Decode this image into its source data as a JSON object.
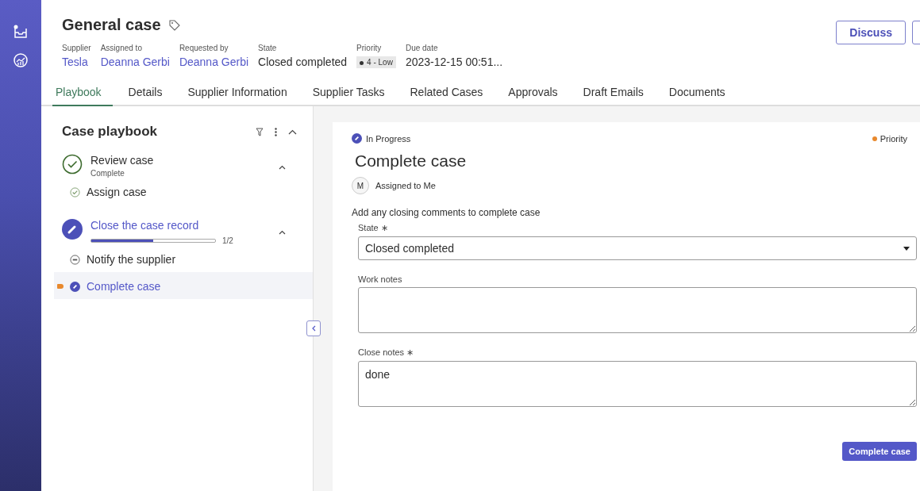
{
  "header": {
    "title": "General case",
    "fields": [
      {
        "label": "Supplier",
        "value": "Tesla",
        "kind": "link"
      },
      {
        "label": "Assigned to",
        "value": "Deanna Gerbi",
        "kind": "link"
      },
      {
        "label": "Requested by",
        "value": "Deanna Gerbi",
        "kind": "link"
      },
      {
        "label": "State",
        "value": "Closed completed",
        "kind": "text"
      },
      {
        "label": "Priority",
        "value": "4 - Low",
        "kind": "badge"
      },
      {
        "label": "Due date",
        "value": "2023-12-15 00:51...",
        "kind": "text"
      }
    ],
    "buttons": [
      "Discuss"
    ]
  },
  "tabs": [
    {
      "label": "Playbook",
      "selected": true
    },
    {
      "label": "Details",
      "selected": false
    },
    {
      "label": "Supplier Information",
      "selected": false
    },
    {
      "label": "Supplier Tasks",
      "selected": false
    },
    {
      "label": "Related Cases",
      "selected": false
    },
    {
      "label": "Approvals",
      "selected": false
    },
    {
      "label": "Draft Emails",
      "selected": false
    },
    {
      "label": "Documents",
      "selected": false
    }
  ],
  "playbook": {
    "title": "Case playbook",
    "groups": [
      {
        "title": "Review case",
        "kind": "complete",
        "subtitle": "Complete",
        "expanded": true,
        "children": [
          {
            "label": "Assign case",
            "kind": "complete",
            "selected": false
          }
        ]
      },
      {
        "title": "Close the case record",
        "kind": "active",
        "level": 0.5,
        "reading": "1/2",
        "expanded": true,
        "children": [
          {
            "label": "Notify the supplier",
            "kind": "pending",
            "selected": false
          },
          {
            "label": "Complete case",
            "kind": "active",
            "selected": true
          }
        ]
      }
    ]
  },
  "detail": {
    "status": "In Progress",
    "priority": "Priority",
    "title": "Complete case",
    "assignee_initial": "M",
    "assignee": "Assigned to Me",
    "instructions": "Add any closing comments to complete case",
    "fields": [
      {
        "label": "State ∗",
        "kind": "select",
        "value": "Closed completed"
      },
      {
        "label": "Work notes",
        "kind": "textarea"
      },
      {
        "label": "Close notes ∗",
        "kind": "textarea",
        "value": "done"
      }
    ],
    "submit": "Complete case"
  }
}
